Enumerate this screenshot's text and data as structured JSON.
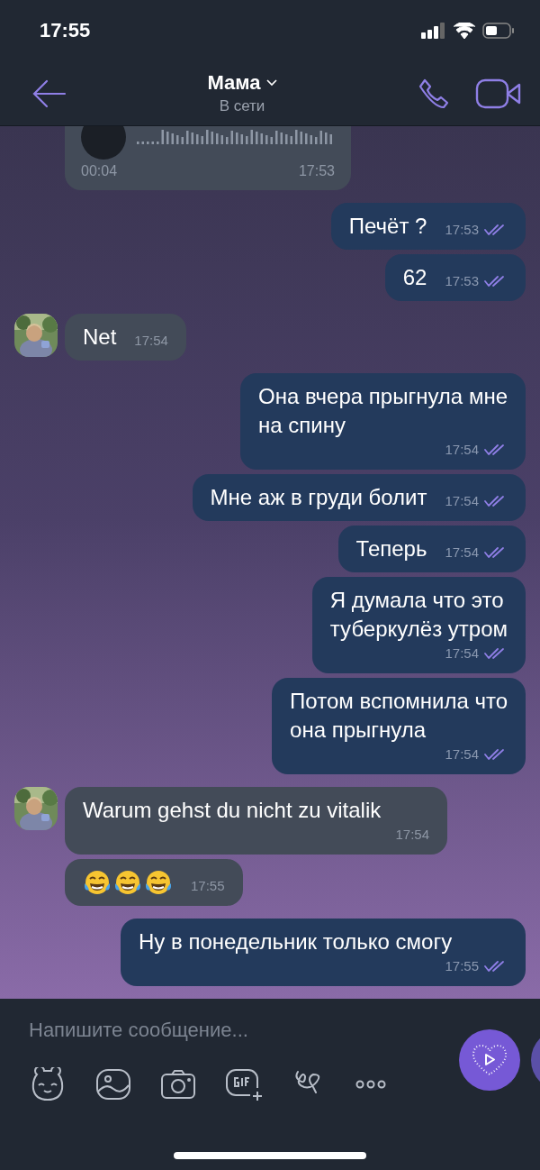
{
  "status_bar": {
    "time": "17:55"
  },
  "header": {
    "title": "Мама",
    "subtitle": "В сети"
  },
  "messages": [
    {
      "kind": "voice",
      "outgoing": false,
      "duration": "00:04",
      "time": "17:53"
    },
    {
      "kind": "text",
      "outgoing": true,
      "text": "Печёт ?",
      "time": "17:53",
      "read": true
    },
    {
      "kind": "text",
      "outgoing": true,
      "text": "62",
      "time": "17:53",
      "read": true
    },
    {
      "kind": "text",
      "outgoing": false,
      "avatar": true,
      "text": "Net",
      "time": "17:54"
    },
    {
      "kind": "text",
      "outgoing": true,
      "text": "Она вчера прыгнула мне\nна спину",
      "time": "17:54",
      "read": true
    },
    {
      "kind": "text",
      "outgoing": true,
      "text": "Мне аж в груди болит",
      "time": "17:54",
      "read": true
    },
    {
      "kind": "text",
      "outgoing": true,
      "text": "Теперь",
      "time": "17:54",
      "read": true
    },
    {
      "kind": "text",
      "outgoing": true,
      "text": "Я думала что это\nтуберкулёз утром",
      "time": "17:54",
      "read": true
    },
    {
      "kind": "text",
      "outgoing": true,
      "text": "Потом вспомнила что\nона прыгнула",
      "time": "17:54",
      "read": true
    },
    {
      "kind": "text",
      "outgoing": false,
      "avatar": true,
      "text": "Warum gehst du nicht zu vitalik",
      "time": "17:54"
    },
    {
      "kind": "emoji",
      "outgoing": false,
      "avatar": false,
      "emojis": [
        {
          "kind": "laughing-tears"
        },
        {
          "kind": "laughing-tears"
        },
        {
          "kind": "laughing-tears"
        }
      ],
      "time": "17:55"
    },
    {
      "kind": "text",
      "outgoing": true,
      "text": "Ну в понедельник только смогу",
      "time": "17:55",
      "read": true
    }
  ],
  "composer": {
    "placeholder": "Напишите сообщение..."
  }
}
